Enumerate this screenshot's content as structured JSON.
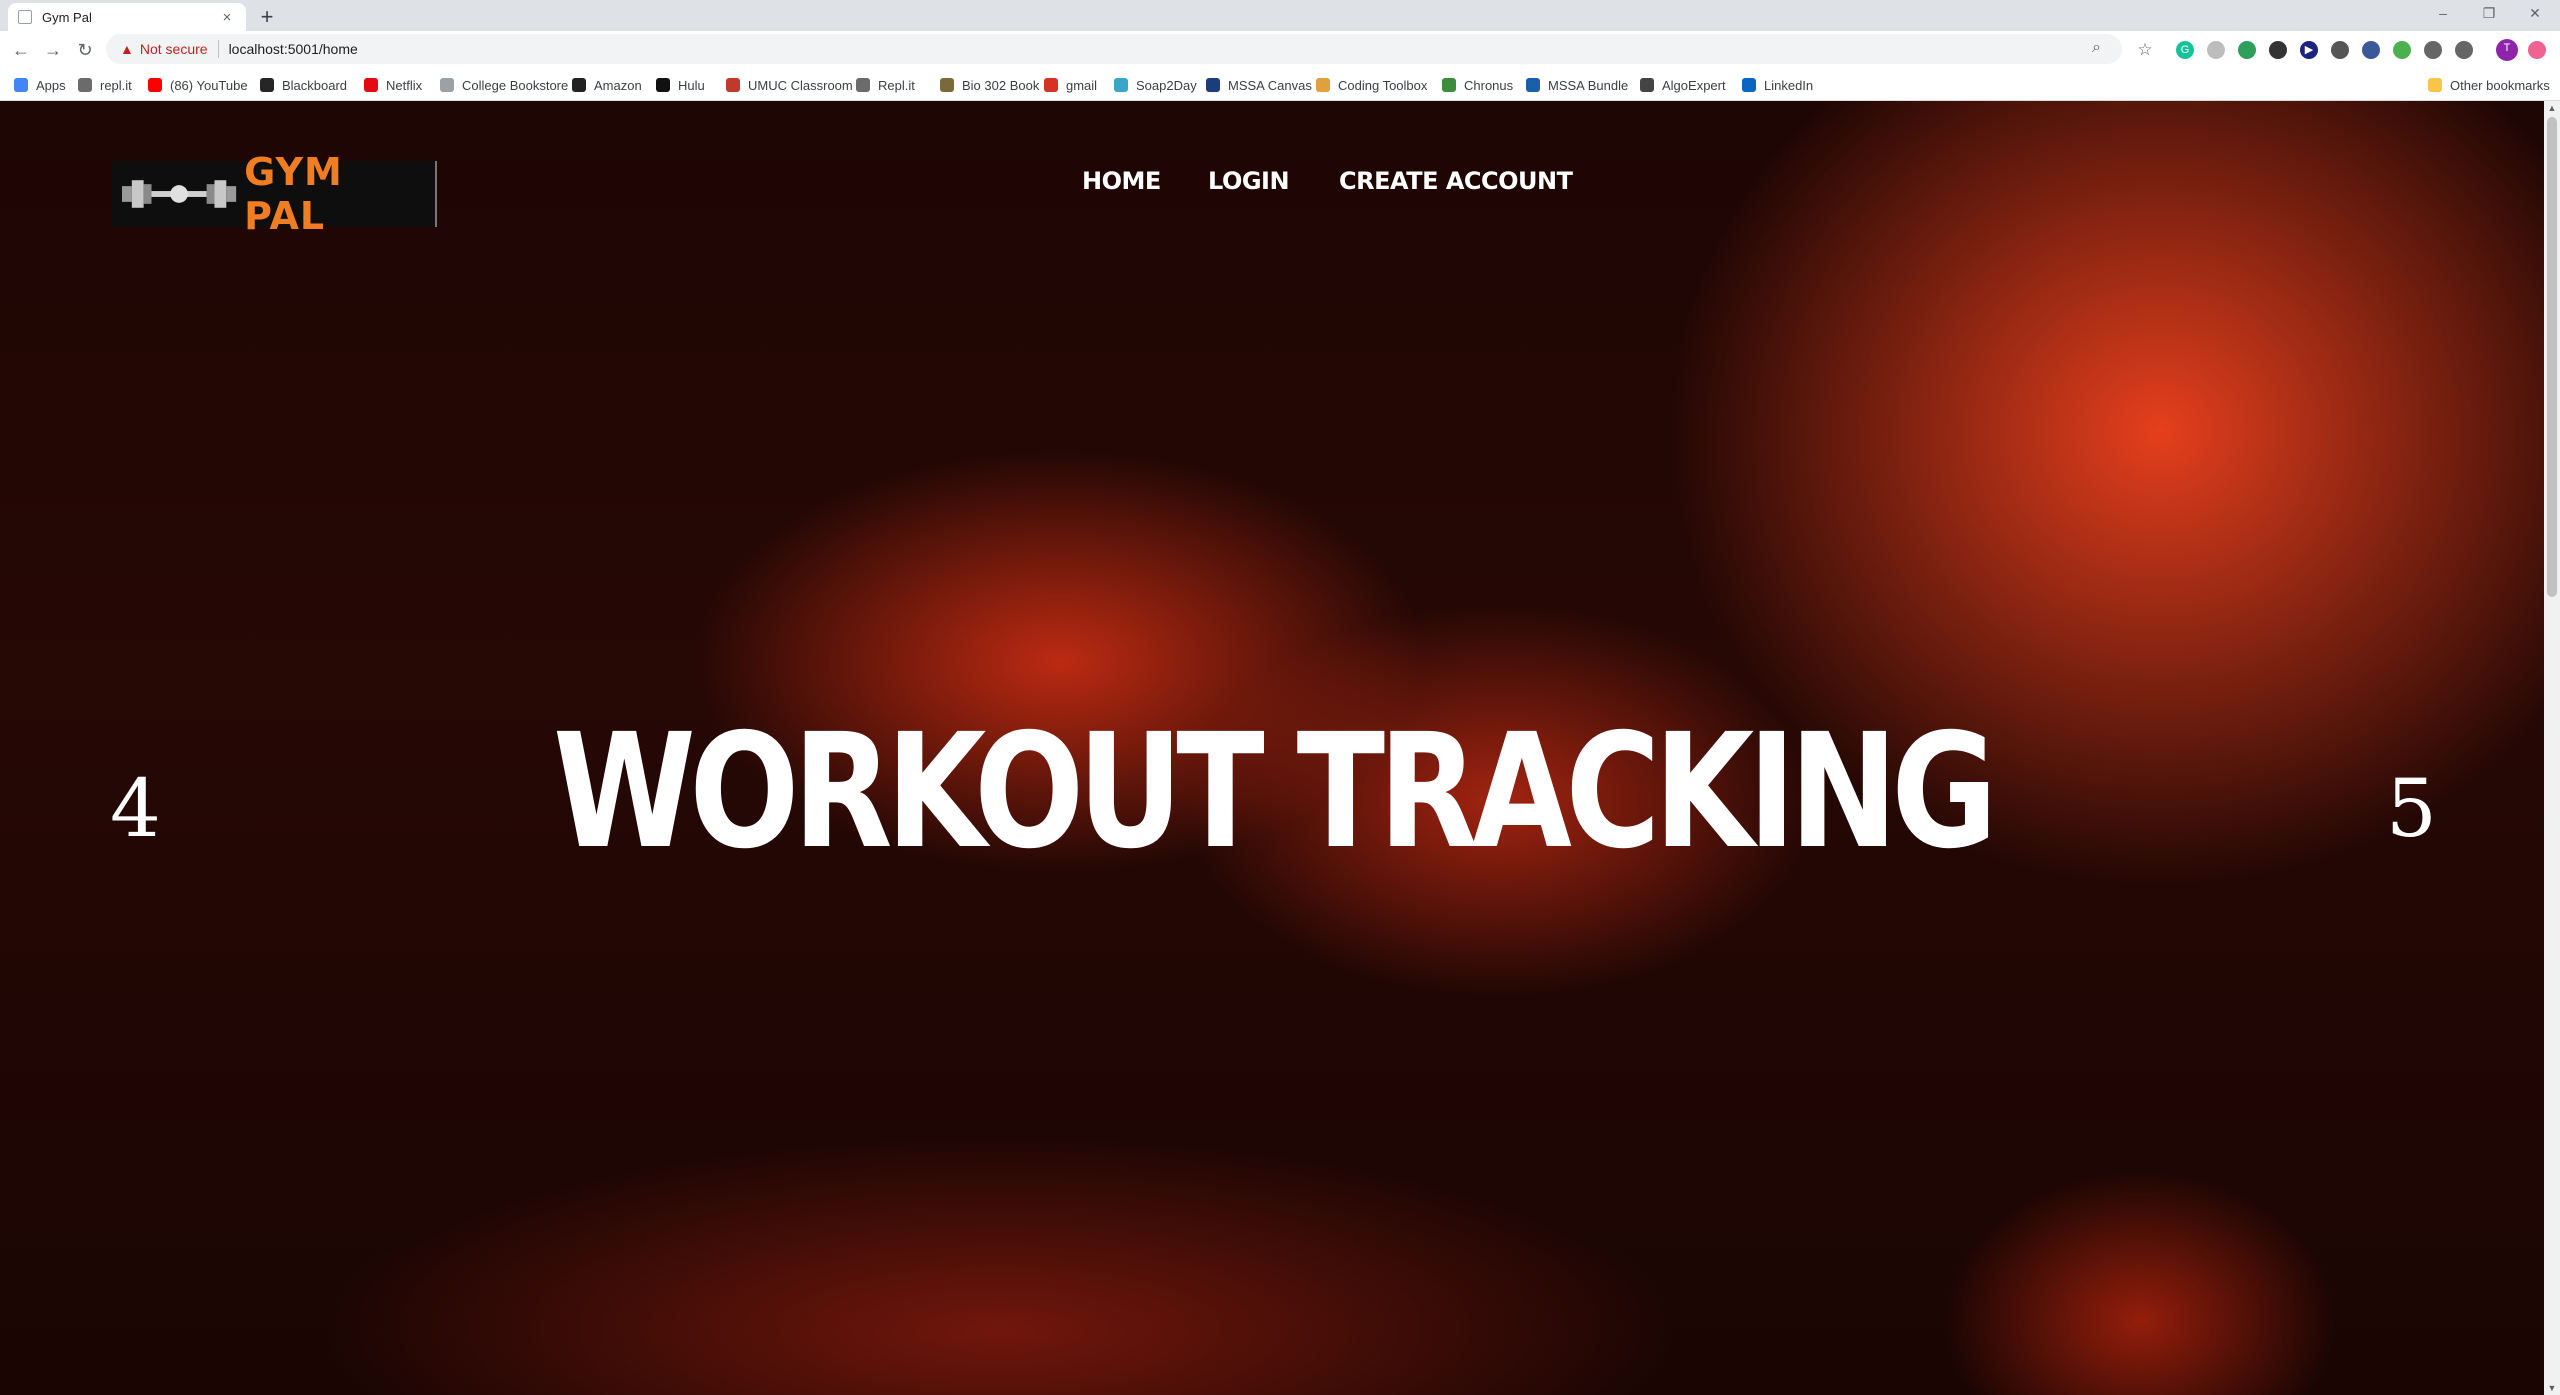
{
  "browser": {
    "tab_title": "Gym Pal",
    "tab_close": "×",
    "new_tab": "+",
    "window_controls": {
      "minimize": "–",
      "restore": "❐",
      "close": "✕"
    },
    "nav": {
      "back": "←",
      "forward": "→",
      "reload": "↻"
    },
    "security_label": "Not secure",
    "url": "localhost:5001/home",
    "bookmarks": [
      {
        "label": "Apps",
        "icon": "apps-grid-icon",
        "color": "#4285f4"
      },
      {
        "label": "repl.it",
        "icon": "replit-icon",
        "color": "#6b6b6b"
      },
      {
        "label": "(86) YouTube",
        "icon": "youtube-icon",
        "color": "#ff0000"
      },
      {
        "label": "Blackboard",
        "icon": "blackboard-icon",
        "color": "#262626"
      },
      {
        "label": "Netflix",
        "icon": "netflix-icon",
        "color": "#e50914"
      },
      {
        "label": "College Bookstore",
        "icon": "page-icon",
        "color": "#9aa0a6"
      },
      {
        "label": "Amazon",
        "icon": "amazon-icon",
        "color": "#222222"
      },
      {
        "label": "Hulu",
        "icon": "hulu-icon",
        "color": "#111111"
      },
      {
        "label": "UMUC Classroom",
        "icon": "umuc-icon",
        "color": "#c0392b"
      },
      {
        "label": "Repl.it",
        "icon": "replit-icon",
        "color": "#6b6b6b"
      },
      {
        "label": "Bio 302 Book",
        "icon": "book-icon",
        "color": "#7a6a3a"
      },
      {
        "label": "gmail",
        "icon": "gmail-icon",
        "color": "#d93025"
      },
      {
        "label": "Soap2Day",
        "icon": "soap2day-icon",
        "color": "#3aa5c9"
      },
      {
        "label": "MSSA Canvas",
        "icon": "canvas-icon",
        "color": "#1a3e7a"
      },
      {
        "label": "Coding Toolbox",
        "icon": "toolbox-icon",
        "color": "#e0a040"
      },
      {
        "label": "Chronus",
        "icon": "chronus-icon",
        "color": "#3b8f3b"
      },
      {
        "label": "MSSA Bundle",
        "icon": "bundle-icon",
        "color": "#1a5fa8"
      },
      {
        "label": "AlgoExpert",
        "icon": "algoexpert-icon",
        "color": "#444444"
      },
      {
        "label": "LinkedIn",
        "icon": "linkedin-icon",
        "color": "#0a66c2"
      }
    ],
    "other_bookmarks": "Other bookmarks"
  },
  "site": {
    "logo_text": "GYM PAL",
    "logo_color": "#f07d21",
    "nav_links": [
      "HOME",
      "LOGIN",
      "CREATE ACCOUNT"
    ],
    "headline": "WORKOUT TRACKING",
    "prev_label": "4",
    "next_label": "5"
  }
}
